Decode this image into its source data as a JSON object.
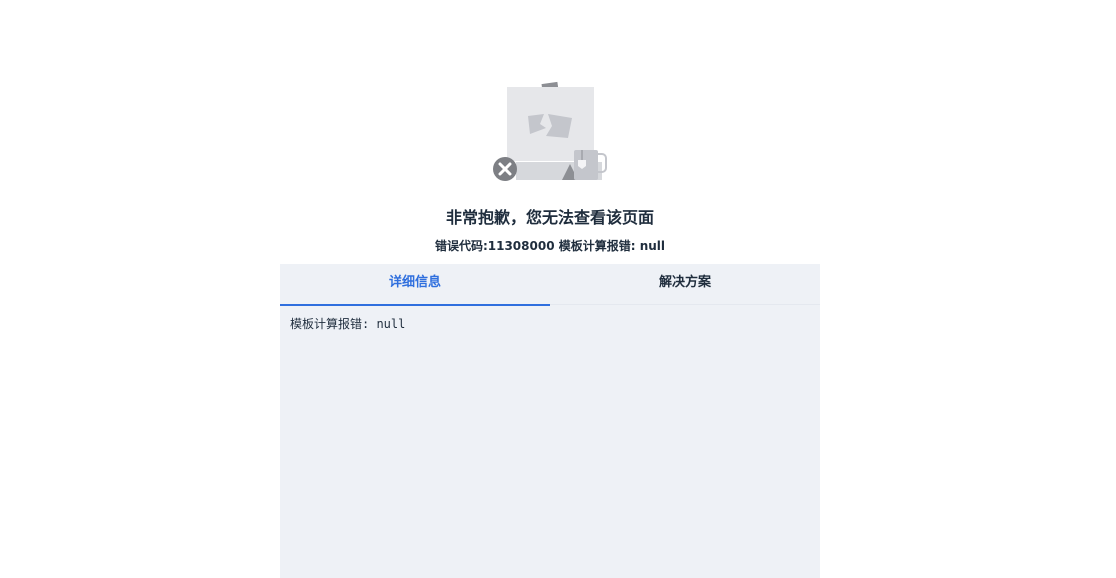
{
  "illustration": {
    "icon": "broken-image-icon",
    "error_badge_icon": "close-icon",
    "mug_icon": "mug-icon",
    "colors": {
      "paper": "#e6e7ea",
      "shape": "#c4c6cc",
      "badge": "#7d7f84"
    }
  },
  "error": {
    "title": "非常抱歉，您无法查看该页面",
    "subtitle": "错误代码:11308000 模板计算报错: null"
  },
  "tabs": [
    {
      "label": "详细信息",
      "active": true
    },
    {
      "label": "解决方案",
      "active": false
    }
  ],
  "detail": {
    "text": "模板计算报错: null"
  },
  "colors": {
    "accent": "#2f6fde",
    "panel_bg": "#eef1f6",
    "text": "#1f2d3d"
  }
}
